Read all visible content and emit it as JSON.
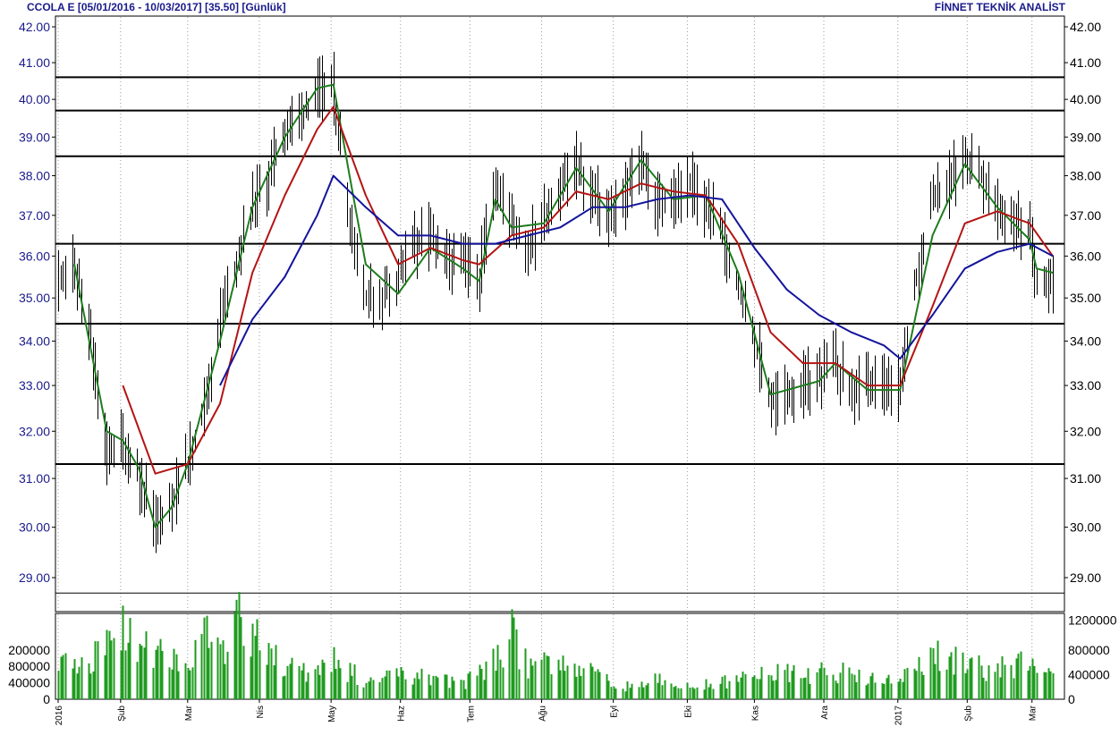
{
  "header": {
    "left": "CCOLA E  [05/01/2016 - 10/03/2017]  [35.50]  [Günlük]",
    "right": "FİNNET TEKNİK ANALİST"
  },
  "chart_data": [
    {
      "type": "line",
      "title": "CCOLA E  [05/01/2016 - 10/03/2017]  [35.50]  [Günlük]",
      "xlabel": "",
      "ylabel": "",
      "ylim": [
        28.7,
        42.3
      ],
      "y_scale": "log",
      "y_ticks": [
        "42.00",
        "41.00",
        "40.00",
        "39.00",
        "38.00",
        "37.00",
        "36.00",
        "35.00",
        "34.00",
        "33.00",
        "32.00",
        "31.00",
        "30.00",
        "29.00"
      ],
      "x_ticks": [
        "2016",
        "Şub",
        "Mar",
        "Nis",
        "May",
        "Haz",
        "Tem",
        "Ağu",
        "Eyl",
        "Eki",
        "Kas",
        "Ara",
        "2017",
        "Şub",
        "Mar"
      ],
      "grid": "vertical dotted",
      "horizontal_levels": [
        40.6,
        39.7,
        38.5,
        36.3,
        34.4,
        31.3,
        28.7
      ],
      "colors": {
        "price_bars": "#000000",
        "ma_short": "#1e7d1e",
        "ma_mid": "#b41414",
        "ma_long": "#14149c",
        "levels": "#000000"
      },
      "price_anchors": [
        {
          "x": "2016-01-05",
          "y": 35.5
        },
        {
          "x": "2016-01-12",
          "y": 35.7
        },
        {
          "x": "2016-01-19",
          "y": 34.0
        },
        {
          "x": "2016-01-26",
          "y": 31.5
        },
        {
          "x": "2016-02-02",
          "y": 31.8
        },
        {
          "x": "2016-02-09",
          "y": 31.0
        },
        {
          "x": "2016-02-16",
          "y": 30.0
        },
        {
          "x": "2016-02-23",
          "y": 30.5
        },
        {
          "x": "2016-03-01",
          "y": 31.3
        },
        {
          "x": "2016-03-08",
          "y": 32.5
        },
        {
          "x": "2016-03-15",
          "y": 34.5
        },
        {
          "x": "2016-03-22",
          "y": 35.8
        },
        {
          "x": "2016-03-29",
          "y": 37.2
        },
        {
          "x": "2016-04-05",
          "y": 38.0
        },
        {
          "x": "2016-04-12",
          "y": 39.2
        },
        {
          "x": "2016-04-19",
          "y": 39.5
        },
        {
          "x": "2016-04-26",
          "y": 40.2
        },
        {
          "x": "2016-05-03",
          "y": 40.3
        },
        {
          "x": "2016-05-10",
          "y": 37.0
        },
        {
          "x": "2016-05-17",
          "y": 35.0
        },
        {
          "x": "2016-05-24",
          "y": 35.0
        },
        {
          "x": "2016-05-31",
          "y": 35.5
        },
        {
          "x": "2016-06-07",
          "y": 36.3
        },
        {
          "x": "2016-06-14",
          "y": 36.5
        },
        {
          "x": "2016-06-21",
          "y": 35.8
        },
        {
          "x": "2016-06-28",
          "y": 35.8
        },
        {
          "x": "2016-07-05",
          "y": 35.5
        },
        {
          "x": "2016-07-12",
          "y": 38.0
        },
        {
          "x": "2016-07-19",
          "y": 36.8
        },
        {
          "x": "2016-07-26",
          "y": 36.2
        },
        {
          "x": "2016-08-02",
          "y": 37.0
        },
        {
          "x": "2016-08-09",
          "y": 37.8
        },
        {
          "x": "2016-08-16",
          "y": 38.3
        },
        {
          "x": "2016-08-23",
          "y": 37.5
        },
        {
          "x": "2016-08-30",
          "y": 37.0
        },
        {
          "x": "2016-09-06",
          "y": 37.5
        },
        {
          "x": "2016-09-13",
          "y": 38.5
        },
        {
          "x": "2016-09-20",
          "y": 37.3
        },
        {
          "x": "2016-09-27",
          "y": 37.5
        },
        {
          "x": "2016-10-04",
          "y": 37.8
        },
        {
          "x": "2016-10-11",
          "y": 37.3
        },
        {
          "x": "2016-10-18",
          "y": 36.5
        },
        {
          "x": "2016-10-25",
          "y": 35.2
        },
        {
          "x": "2016-11-01",
          "y": 34.0
        },
        {
          "x": "2016-11-08",
          "y": 32.7
        },
        {
          "x": "2016-11-15",
          "y": 32.8
        },
        {
          "x": "2016-11-22",
          "y": 33.0
        },
        {
          "x": "2016-11-29",
          "y": 33.2
        },
        {
          "x": "2016-12-06",
          "y": 33.5
        },
        {
          "x": "2016-12-13",
          "y": 32.8
        },
        {
          "x": "2016-12-20",
          "y": 33.0
        },
        {
          "x": "2016-12-27",
          "y": 33.0
        },
        {
          "x": "2017-01-03",
          "y": 32.9
        },
        {
          "x": "2017-01-10",
          "y": 35.5
        },
        {
          "x": "2017-01-17",
          "y": 37.5
        },
        {
          "x": "2017-01-24",
          "y": 37.8
        },
        {
          "x": "2017-01-31",
          "y": 38.5
        },
        {
          "x": "2017-02-07",
          "y": 38.0
        },
        {
          "x": "2017-02-14",
          "y": 37.0
        },
        {
          "x": "2017-02-21",
          "y": 37.0
        },
        {
          "x": "2017-02-28",
          "y": 36.5
        },
        {
          "x": "2017-03-03",
          "y": 35.5
        },
        {
          "x": "2017-03-10",
          "y": 35.5
        }
      ],
      "series": [
        {
          "name": "",
          "role": "ma_short",
          "points": [
            [
              "2016-01-12",
              35.8
            ],
            [
              "2016-01-26",
              32.0
            ],
            [
              "2016-02-02",
              31.8
            ],
            [
              "2016-02-09",
              31.2
            ],
            [
              "2016-02-16",
              30.0
            ],
            [
              "2016-02-23",
              30.4
            ],
            [
              "2016-03-01",
              31.3
            ],
            [
              "2016-03-15",
              34.0
            ],
            [
              "2016-03-29",
              37.2
            ],
            [
              "2016-04-12",
              39.0
            ],
            [
              "2016-04-26",
              40.3
            ],
            [
              "2016-05-03",
              40.4
            ],
            [
              "2016-05-10",
              38.0
            ],
            [
              "2016-05-17",
              35.8
            ],
            [
              "2016-05-31",
              35.1
            ],
            [
              "2016-06-14",
              36.2
            ],
            [
              "2016-06-28",
              35.7
            ],
            [
              "2016-07-05",
              35.4
            ],
            [
              "2016-07-12",
              37.4
            ],
            [
              "2016-07-19",
              36.7
            ],
            [
              "2016-08-02",
              36.8
            ],
            [
              "2016-08-16",
              38.2
            ],
            [
              "2016-08-30",
              37.1
            ],
            [
              "2016-09-13",
              38.4
            ],
            [
              "2016-09-27",
              37.4
            ],
            [
              "2016-10-11",
              37.5
            ],
            [
              "2016-10-25",
              35.6
            ],
            [
              "2016-11-08",
              32.8
            ],
            [
              "2016-11-29",
              33.1
            ],
            [
              "2016-12-06",
              33.5
            ],
            [
              "2016-12-20",
              32.9
            ],
            [
              "2017-01-03",
              32.9
            ],
            [
              "2017-01-17",
              36.5
            ],
            [
              "2017-01-31",
              38.3
            ],
            [
              "2017-02-14",
              37.2
            ],
            [
              "2017-02-28",
              36.4
            ],
            [
              "2017-03-03",
              35.7
            ],
            [
              "2017-03-10",
              35.6
            ]
          ]
        },
        {
          "name": "",
          "role": "ma_mid",
          "points": [
            [
              "2016-02-02",
              33.0
            ],
            [
              "2016-02-16",
              31.1
            ],
            [
              "2016-03-01",
              31.3
            ],
            [
              "2016-03-15",
              32.6
            ],
            [
              "2016-03-29",
              35.6
            ],
            [
              "2016-04-12",
              37.5
            ],
            [
              "2016-04-26",
              39.2
            ],
            [
              "2016-05-03",
              39.8
            ],
            [
              "2016-05-17",
              37.5
            ],
            [
              "2016-05-31",
              35.8
            ],
            [
              "2016-06-14",
              36.2
            ],
            [
              "2016-06-28",
              35.9
            ],
            [
              "2016-07-05",
              35.8
            ],
            [
              "2016-07-19",
              36.5
            ],
            [
              "2016-08-02",
              36.7
            ],
            [
              "2016-08-16",
              37.6
            ],
            [
              "2016-08-30",
              37.4
            ],
            [
              "2016-09-13",
              37.8
            ],
            [
              "2016-09-27",
              37.6
            ],
            [
              "2016-10-11",
              37.5
            ],
            [
              "2016-10-25",
              36.3
            ],
            [
              "2016-11-08",
              34.2
            ],
            [
              "2016-11-22",
              33.5
            ],
            [
              "2016-12-06",
              33.5
            ],
            [
              "2016-12-20",
              33.0
            ],
            [
              "2017-01-03",
              33.0
            ],
            [
              "2017-01-17",
              34.8
            ],
            [
              "2017-01-31",
              36.8
            ],
            [
              "2017-02-14",
              37.1
            ],
            [
              "2017-02-28",
              36.8
            ],
            [
              "2017-03-10",
              36.0
            ]
          ]
        },
        {
          "name": "",
          "role": "ma_long",
          "points": [
            [
              "2016-03-15",
              33.0
            ],
            [
              "2016-03-29",
              34.5
            ],
            [
              "2016-04-12",
              35.5
            ],
            [
              "2016-04-26",
              37.0
            ],
            [
              "2016-05-03",
              38.0
            ],
            [
              "2016-05-17",
              37.2
            ],
            [
              "2016-05-31",
              36.5
            ],
            [
              "2016-06-14",
              36.5
            ],
            [
              "2016-06-28",
              36.3
            ],
            [
              "2016-07-12",
              36.3
            ],
            [
              "2016-07-26",
              36.5
            ],
            [
              "2016-08-09",
              36.7
            ],
            [
              "2016-08-23",
              37.2
            ],
            [
              "2016-09-06",
              37.2
            ],
            [
              "2016-09-20",
              37.4
            ],
            [
              "2016-10-04",
              37.5
            ],
            [
              "2016-10-18",
              37.4
            ],
            [
              "2016-11-01",
              36.2
            ],
            [
              "2016-11-15",
              35.2
            ],
            [
              "2016-11-29",
              34.6
            ],
            [
              "2016-12-13",
              34.2
            ],
            [
              "2016-12-27",
              33.9
            ],
            [
              "2017-01-03",
              33.6
            ],
            [
              "2017-01-17",
              34.6
            ],
            [
              "2017-01-31",
              35.7
            ],
            [
              "2017-02-14",
              36.1
            ],
            [
              "2017-02-28",
              36.3
            ],
            [
              "2017-03-10",
              36.0
            ]
          ]
        }
      ]
    },
    {
      "type": "bar",
      "title": "",
      "xlabel": "",
      "ylabel": "",
      "left_ticks": [
        "200000",
        "800000",
        "400000",
        "0"
      ],
      "right_ticks": [
        "1200000",
        "800000",
        "400000",
        "0"
      ],
      "ylim": [
        0,
        1250000
      ],
      "x_ticks": [
        "2016",
        "Şub",
        "Mar",
        "Nis",
        "May",
        "Haz",
        "Tem",
        "Ağu",
        "Eyl",
        "Eki",
        "Kas",
        "Ara",
        "2017",
        "Şub",
        "Mar"
      ],
      "bar_color": "#1f9b1f",
      "volume_anchors": [
        {
          "x": "2016-01-05",
          "y": 550000
        },
        {
          "x": "2016-01-19",
          "y": 650000
        },
        {
          "x": "2016-02-02",
          "y": 1100000
        },
        {
          "x": "2016-02-09",
          "y": 900000
        },
        {
          "x": "2016-02-23",
          "y": 600000
        },
        {
          "x": "2016-03-01",
          "y": 450000
        },
        {
          "x": "2016-03-08",
          "y": 1050000
        },
        {
          "x": "2016-03-15",
          "y": 700000
        },
        {
          "x": "2016-03-22",
          "y": 1300000
        },
        {
          "x": "2016-04-05",
          "y": 700000
        },
        {
          "x": "2016-04-19",
          "y": 400000
        },
        {
          "x": "2016-05-03",
          "y": 600000
        },
        {
          "x": "2016-05-17",
          "y": 300000
        },
        {
          "x": "2016-06-07",
          "y": 400000
        },
        {
          "x": "2016-06-28",
          "y": 250000
        },
        {
          "x": "2016-07-12",
          "y": 600000
        },
        {
          "x": "2016-07-19",
          "y": 1050000
        },
        {
          "x": "2016-07-26",
          "y": 500000
        },
        {
          "x": "2016-08-09",
          "y": 700000
        },
        {
          "x": "2016-08-23",
          "y": 400000
        },
        {
          "x": "2016-09-06",
          "y": 200000
        },
        {
          "x": "2016-09-20",
          "y": 300000
        },
        {
          "x": "2016-10-04",
          "y": 200000
        },
        {
          "x": "2016-10-25",
          "y": 300000
        },
        {
          "x": "2016-11-08",
          "y": 450000
        },
        {
          "x": "2016-11-22",
          "y": 400000
        },
        {
          "x": "2016-12-06",
          "y": 450000
        },
        {
          "x": "2016-12-20",
          "y": 300000
        },
        {
          "x": "2017-01-03",
          "y": 300000
        },
        {
          "x": "2017-01-17",
          "y": 700000
        },
        {
          "x": "2017-01-31",
          "y": 550000
        },
        {
          "x": "2017-02-14",
          "y": 450000
        },
        {
          "x": "2017-02-28",
          "y": 700000
        },
        {
          "x": "2017-03-10",
          "y": 300000
        }
      ]
    }
  ]
}
